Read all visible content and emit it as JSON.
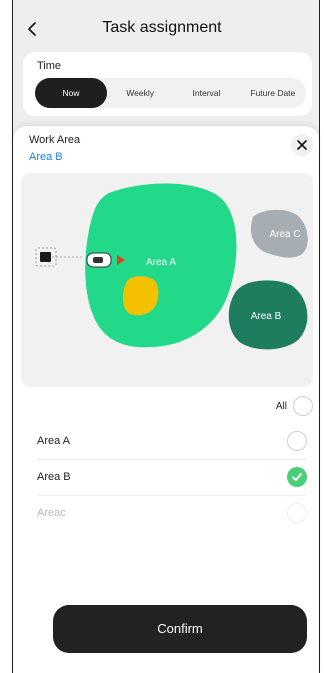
{
  "header": {
    "title": "Task assignment"
  },
  "time": {
    "label": "Time",
    "options": [
      "Now",
      "Weekly",
      "Interval",
      "Future Date"
    ],
    "selected": "Now"
  },
  "sheet": {
    "title": "Work Area",
    "selected_area": "Area B",
    "map": {
      "areas": [
        "Area A",
        "Area C",
        "Area B"
      ]
    },
    "all_label": "All",
    "items": [
      {
        "label": "Area A",
        "state": "unchecked"
      },
      {
        "label": "Area B",
        "state": "checked"
      },
      {
        "label": "Areac",
        "state": "disabled"
      }
    ],
    "confirm_label": "Confirm"
  },
  "colors": {
    "area_a": "#22d98a",
    "area_b": "#1f7d5f",
    "area_c": "#a6aeb3",
    "no_go_zone": "#f4c100",
    "selected_text": "#1e7fd6",
    "check": "#4ccd77"
  }
}
